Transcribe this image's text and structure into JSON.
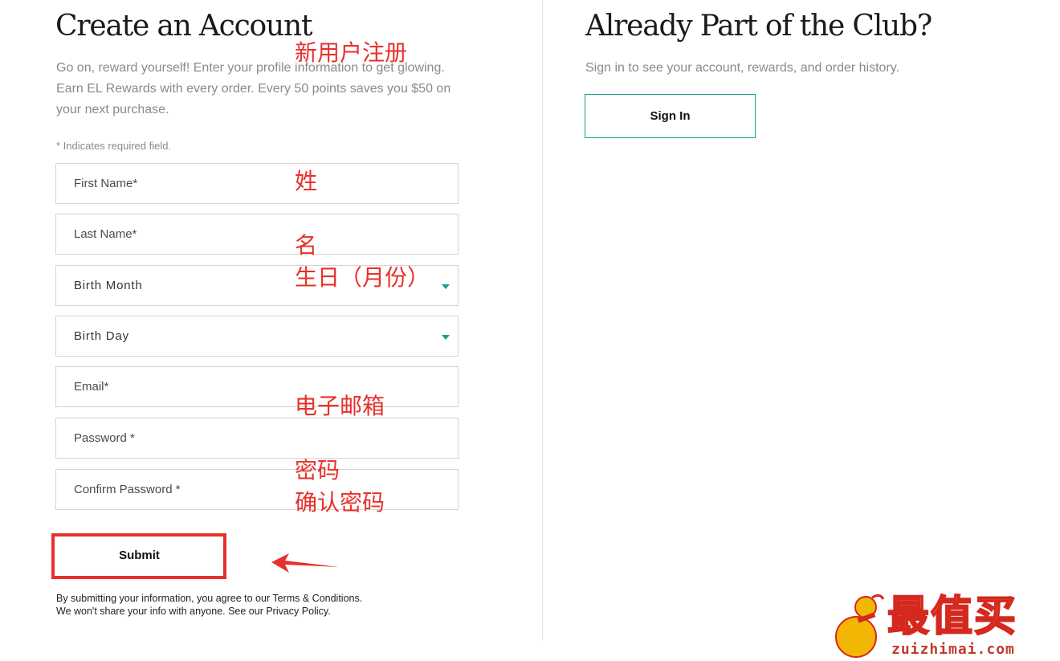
{
  "create_account": {
    "title": "Create an Account",
    "intro": "Go on, reward yourself! Enter your profile information to get glowing. Earn EL Rewards with every order. Every 50 points saves you $50 on your next purchase.",
    "required_note": "* Indicates required field.",
    "fields": {
      "first_name": "First Name*",
      "last_name": "Last Name*",
      "birth_month": "Birth Month",
      "birth_day": "Birth Day",
      "email": "Email*",
      "password": "Password *",
      "confirm_password": "Confirm Password *"
    },
    "submit_label": "Submit",
    "disclaimer_line1_prefix": "By submitting your information, you agree to our ",
    "terms_link": "Terms & Conditions",
    "disclaimer_line1_suffix": ".",
    "disclaimer_line2_prefix": "We won't share your info with anyone. See our ",
    "privacy_link": "Privacy Policy",
    "disclaimer_line2_suffix": "."
  },
  "sign_in": {
    "title": "Already Part of the Club?",
    "intro": "Sign in to see your account, rewards, and order history.",
    "button_label": "Sign In"
  },
  "annotations": {
    "new_user_register": "新用户注册",
    "first_name": "姓",
    "last_name": "名",
    "birth_month": "生日（月份）",
    "email": "电子邮箱",
    "password": "密码",
    "confirm_password": "确认密码"
  },
  "watermark": {
    "brand": "最值买",
    "domain": "zuizhimai.com"
  },
  "colors": {
    "accent": "#16a08d",
    "annotation_red": "#e8302b",
    "muted_text": "#8a8a8a"
  }
}
